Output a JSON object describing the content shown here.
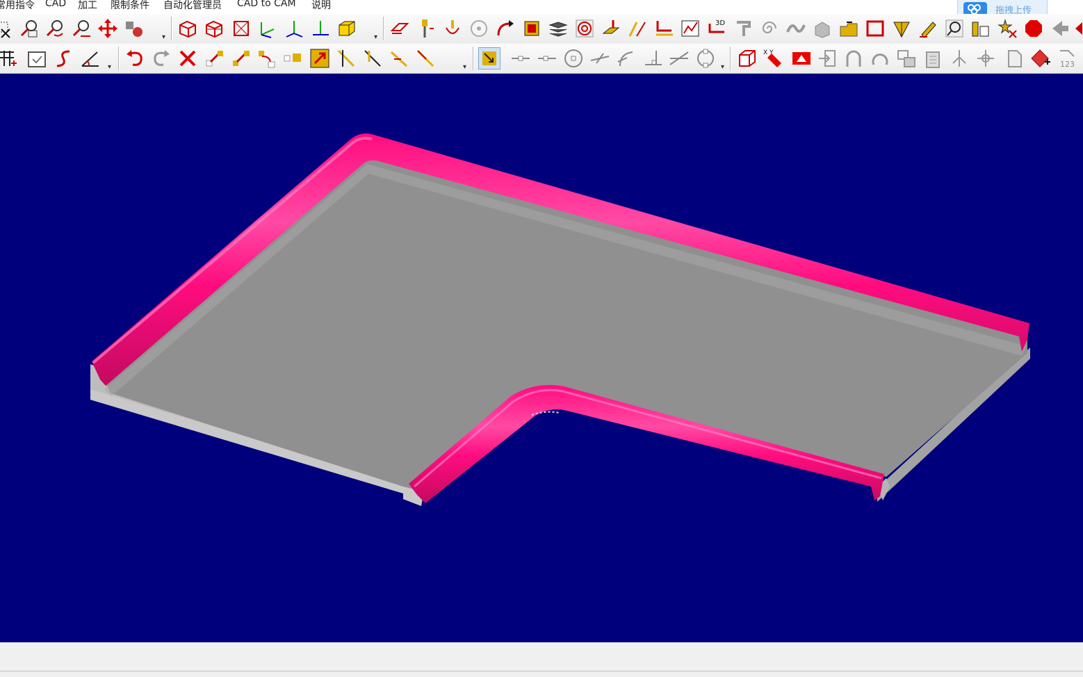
{
  "menu": [
    "常用指令",
    "CAD",
    "加工",
    "限制条件",
    "自动化管理员",
    "CAD to CAM",
    "说明"
  ],
  "upload_button": {
    "label": "拖拽上传"
  },
  "toolbar1": {
    "buttons": [
      "zoom-window-icon",
      "zoom-fit-icon",
      "zoom-previous-icon",
      "zoom-out-icon",
      "pan-icon",
      "rotate-view-icon",
      "iso-view-icon",
      "front-view-icon",
      "top-view-icon",
      "axis-xy-icon",
      "axis-xyz-icon",
      "axis-iso-icon",
      "solid-box-icon",
      "surface-path-icon",
      "drill-icon",
      "plunge-icon",
      "circle-icon",
      "arrow-path-icon",
      "cut-icon",
      "layers-icon",
      "target-icon",
      "tool-icon",
      "curve-icon",
      "offset-icon",
      "chart-icon",
      "3d-path-icon",
      "lathe-icon",
      "spiral-icon",
      "wave-icon",
      "stack-icon",
      "folder-icon",
      "rectangle-icon",
      "measure-icon",
      "pencil-icon",
      "circle-arrow-icon",
      "ruler-icon",
      "star-icon",
      "stop-icon",
      "arrow-icon"
    ],
    "badge_3d": "3D"
  },
  "toolbar2": {
    "buttons": [
      "grid-add-icon",
      "calendar-check-icon",
      "s-curve-icon",
      "angle-icon",
      "undo-icon",
      "redo-icon",
      "delete-icon",
      "trim-icon",
      "extend-icon",
      "rotate-move-icon",
      "scale-icon",
      "move-icon",
      "break-icon",
      "split-icon",
      "line-a-icon",
      "line-b-icon",
      "snap-icon",
      "dash-line-icon",
      "dash-point-icon",
      "circle-center-icon",
      "perpendicular-icon",
      "tangent-icon",
      "angle-snap-icon",
      "intersection-icon",
      "octagon-icon",
      "box3d-icon",
      "xy-tool-icon",
      "triangle-icon",
      "import-icon",
      "arc-icon",
      "rotate-arc-icon",
      "copy-icon",
      "paste-icon",
      "mirror-icon",
      "origin-icon",
      "doc-icon",
      "gear-red-icon",
      "numbering-icon"
    ],
    "badge_xy": "X Y",
    "badge_123": "123"
  },
  "viewport": {
    "background": "#00007d",
    "surface_color": "#909090",
    "molding_color": "#ff0c7f",
    "edge_color": "#c6c6c6"
  },
  "statusbar": {
    "text": ""
  }
}
